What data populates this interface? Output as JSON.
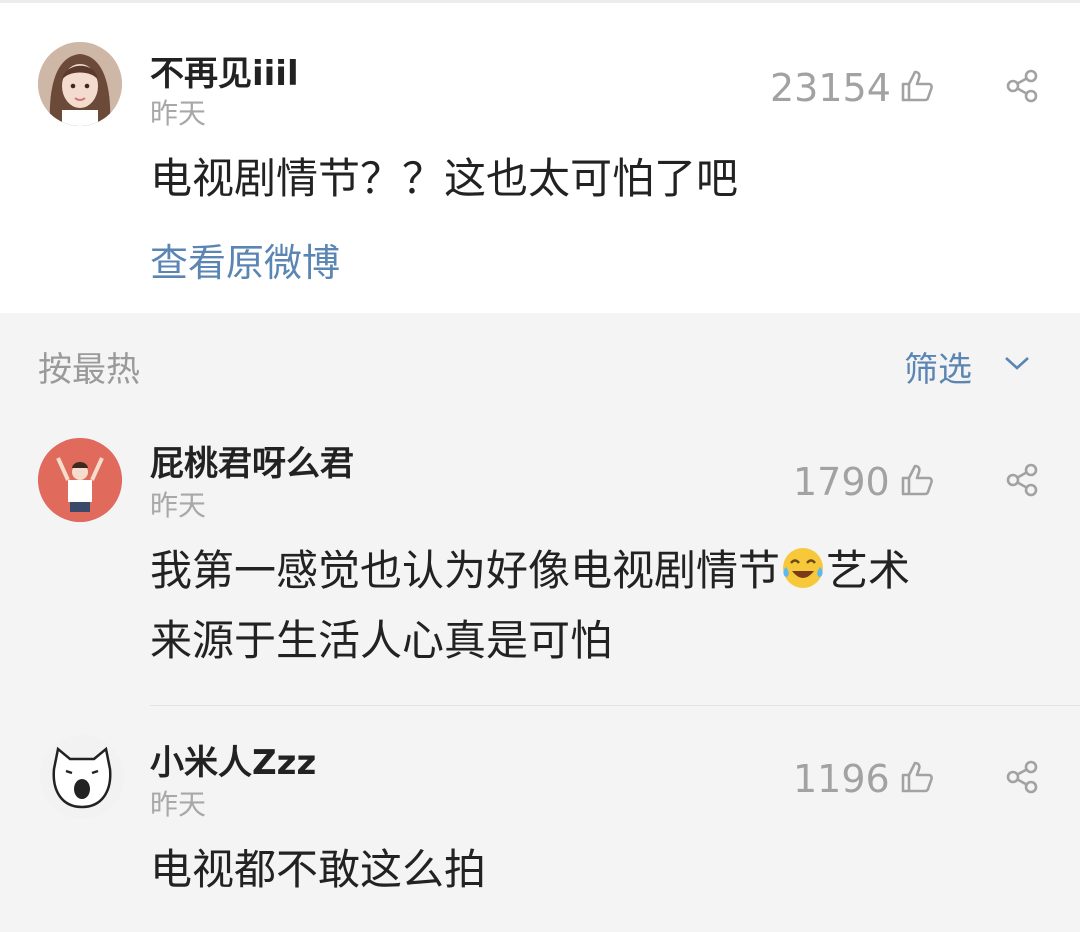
{
  "post": {
    "username": "不再见iiil",
    "time": "昨天",
    "likes": "23154",
    "text": "电视剧情节？？这也太可怕了吧",
    "view_original": "查看原微博"
  },
  "sort": {
    "label": "按最热",
    "filter_label": "筛选"
  },
  "comments": [
    {
      "username": "屁桃君呀么君",
      "time": "昨天",
      "likes": "1790",
      "text_line1": "我第一感觉也认为好像电视剧情节",
      "emoji": "laughing-crying-emoji",
      "text_line1_tail": "艺术",
      "text_line2": "来源于生活人心真是可怕"
    },
    {
      "username": "小米人Zzz",
      "time": "昨天",
      "likes": "1196",
      "text": "电视都不敢这么拍"
    }
  ],
  "icons": [
    "like-icon",
    "share-icon",
    "chevron-down-icon"
  ],
  "colors": {
    "link": "#5b86b4",
    "muted": "#a2a2a2",
    "background": "#f4f4f4"
  }
}
